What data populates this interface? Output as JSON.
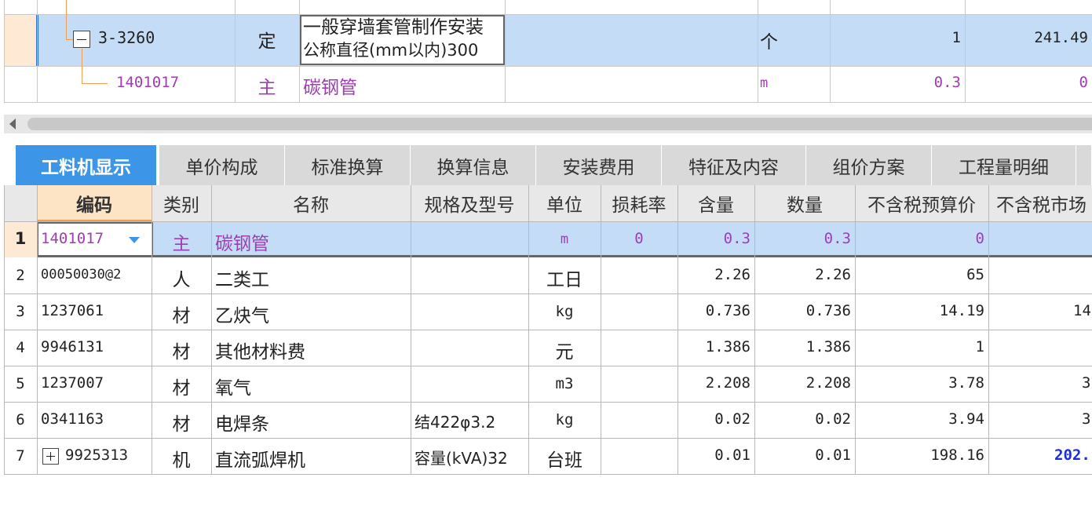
{
  "top_rows": [
    {
      "code": "3-3260",
      "type": "定",
      "name_line1": "一般穿墙套管制作安装",
      "name_line2": "公称直径(mm以内)300",
      "unit": "个",
      "qty": "1",
      "price": "241.49"
    },
    {
      "code": "1401017",
      "type": "主",
      "name": "碳钢管",
      "unit": "m",
      "qty": "0.3",
      "price": "0"
    }
  ],
  "tabs": [
    "工料机显示",
    "单价构成",
    "标准换算",
    "换算信息",
    "安装费用",
    "特征及内容",
    "组价方案",
    "工程量明细"
  ],
  "columns": [
    "编码",
    "类别",
    "名称",
    "规格及型号",
    "单位",
    "损耗率",
    "含量",
    "数量",
    "不含税预算价",
    "不含税市场"
  ],
  "rows": [
    {
      "idx": "1",
      "code": "1401017",
      "type": "主",
      "name": "碳钢管",
      "spec": "",
      "unit": "m",
      "loss": "0",
      "content": "0.3",
      "qty": "0.3",
      "budget": "0",
      "market": ""
    },
    {
      "idx": "2",
      "code": "00050030@2",
      "type": "人",
      "name": "二类工",
      "spec": "",
      "unit": "工日",
      "loss": "",
      "content": "2.26",
      "qty": "2.26",
      "budget": "65",
      "market": ""
    },
    {
      "idx": "3",
      "code": "1237061",
      "type": "材",
      "name": "乙炔气",
      "spec": "",
      "unit": "kg",
      "loss": "",
      "content": "0.736",
      "qty": "0.736",
      "budget": "14.19",
      "market": "14."
    },
    {
      "idx": "4",
      "code": "9946131",
      "type": "材",
      "name": "其他材料费",
      "spec": "",
      "unit": "元",
      "loss": "",
      "content": "1.386",
      "qty": "1.386",
      "budget": "1",
      "market": ""
    },
    {
      "idx": "5",
      "code": "1237007",
      "type": "材",
      "name": "氧气",
      "spec": "",
      "unit": "m3",
      "loss": "",
      "content": "2.208",
      "qty": "2.208",
      "budget": "3.78",
      "market": "3."
    },
    {
      "idx": "6",
      "code": "0341163",
      "type": "材",
      "name": "电焊条",
      "spec": "结422φ3.2",
      "unit": "kg",
      "loss": "",
      "content": "0.02",
      "qty": "0.02",
      "budget": "3.94",
      "market": "3."
    },
    {
      "idx": "7",
      "code": "9925313",
      "type": "机",
      "name": "直流弧焊机",
      "spec": "容量(kVA)32",
      "unit": "台班",
      "loss": "",
      "content": "0.01",
      "qty": "0.01",
      "budget": "198.16",
      "market": "202."
    }
  ],
  "colors": {
    "accent": "#3d95e8",
    "selected_row": "#c5dcf7",
    "main_material": "#a03cb4",
    "link_blue": "#1a2ee0",
    "tree_line": "#f0a050"
  }
}
